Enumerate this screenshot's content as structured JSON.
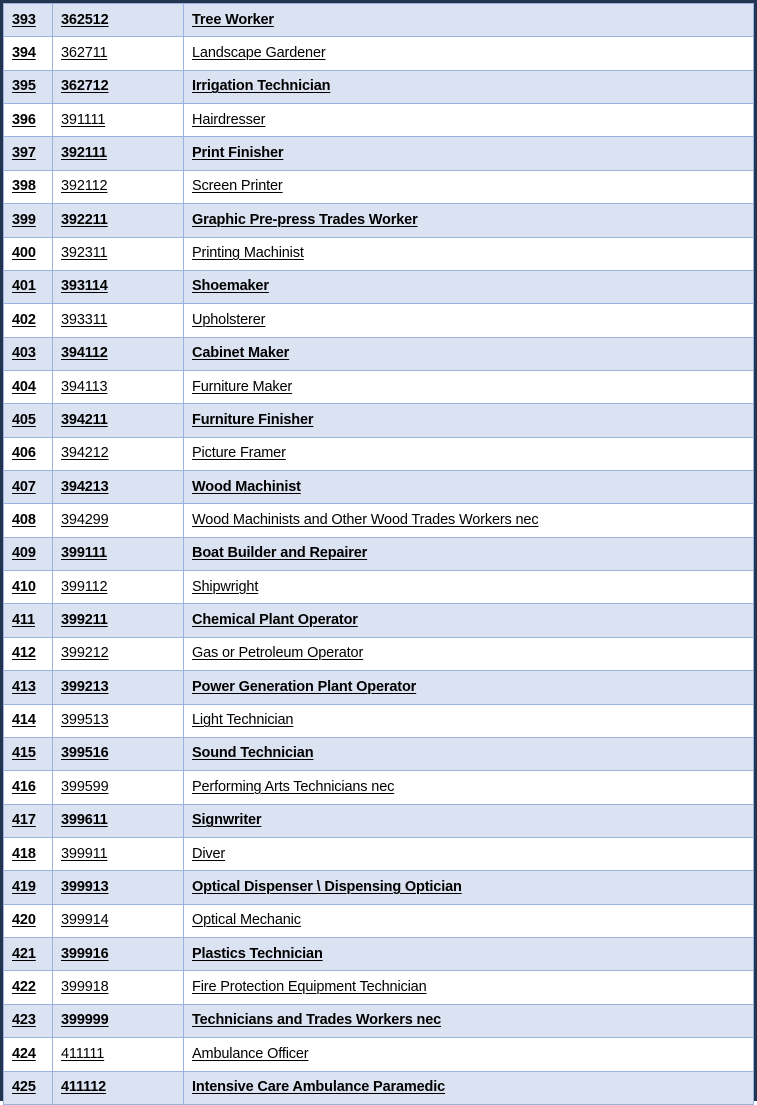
{
  "table": {
    "columns": [
      "index",
      "code",
      "title"
    ],
    "rows": [
      {
        "index": "393",
        "code": "362512",
        "title": "Tree Worker"
      },
      {
        "index": "394",
        "code": "362711",
        "title": "Landscape Gardener"
      },
      {
        "index": "395",
        "code": "362712",
        "title": "Irrigation Technician"
      },
      {
        "index": "396",
        "code": "391111",
        "title": "Hairdresser"
      },
      {
        "index": "397",
        "code": "392111",
        "title": "Print Finisher"
      },
      {
        "index": "398",
        "code": "392112",
        "title": "Screen Printer"
      },
      {
        "index": "399",
        "code": "392211",
        "title": "Graphic Pre-press Trades Worker"
      },
      {
        "index": "400",
        "code": "392311",
        "title": "Printing Machinist"
      },
      {
        "index": "401",
        "code": "393114",
        "title": "Shoemaker"
      },
      {
        "index": "402",
        "code": "393311",
        "title": "Upholsterer"
      },
      {
        "index": "403",
        "code": "394112",
        "title": "Cabinet Maker"
      },
      {
        "index": "404",
        "code": "394113",
        "title": "Furniture Maker"
      },
      {
        "index": "405",
        "code": "394211",
        "title": "Furniture Finisher"
      },
      {
        "index": "406",
        "code": "394212",
        "title": "Picture Framer"
      },
      {
        "index": "407",
        "code": "394213",
        "title": "Wood Machinist"
      },
      {
        "index": "408",
        "code": "394299",
        "title": "Wood Machinists and Other Wood Trades Workers nec"
      },
      {
        "index": "409",
        "code": "399111",
        "title": "Boat Builder and Repairer"
      },
      {
        "index": "410",
        "code": "399112",
        "title": "Shipwright"
      },
      {
        "index": "411",
        "code": "399211",
        "title": "Chemical Plant Operator"
      },
      {
        "index": "412",
        "code": "399212",
        "title": "Gas or Petroleum Operator"
      },
      {
        "index": "413",
        "code": "399213",
        "title": "Power Generation Plant Operator"
      },
      {
        "index": "414",
        "code": "399513",
        "title": "Light Technician"
      },
      {
        "index": "415",
        "code": "399516",
        "title": "Sound Technician"
      },
      {
        "index": "416",
        "code": "399599",
        "title": "Performing Arts Technicians nec"
      },
      {
        "index": "417",
        "code": "399611",
        "title": "Signwriter"
      },
      {
        "index": "418",
        "code": "399911",
        "title": "Diver"
      },
      {
        "index": "419",
        "code": "399913",
        "title": "Optical Dispenser \\ Dispensing Optician"
      },
      {
        "index": "420",
        "code": "399914",
        "title": "Optical Mechanic"
      },
      {
        "index": "421",
        "code": "399916",
        "title": "Plastics Technician"
      },
      {
        "index": "422",
        "code": "399918",
        "title": "Fire Protection Equipment Technician"
      },
      {
        "index": "423",
        "code": "399999",
        "title": "Technicians and Trades Workers nec"
      },
      {
        "index": "424",
        "code": "411111",
        "title": "Ambulance Officer"
      },
      {
        "index": "425",
        "code": "411112",
        "title": "Intensive Care Ambulance Paramedic"
      }
    ]
  },
  "colors": {
    "row_shaded_background": "#dbe2f1",
    "row_plain_background": "#ffffff",
    "cell_border": "#9cb2de",
    "outer_frame": "#22344f",
    "text": "#000000"
  }
}
